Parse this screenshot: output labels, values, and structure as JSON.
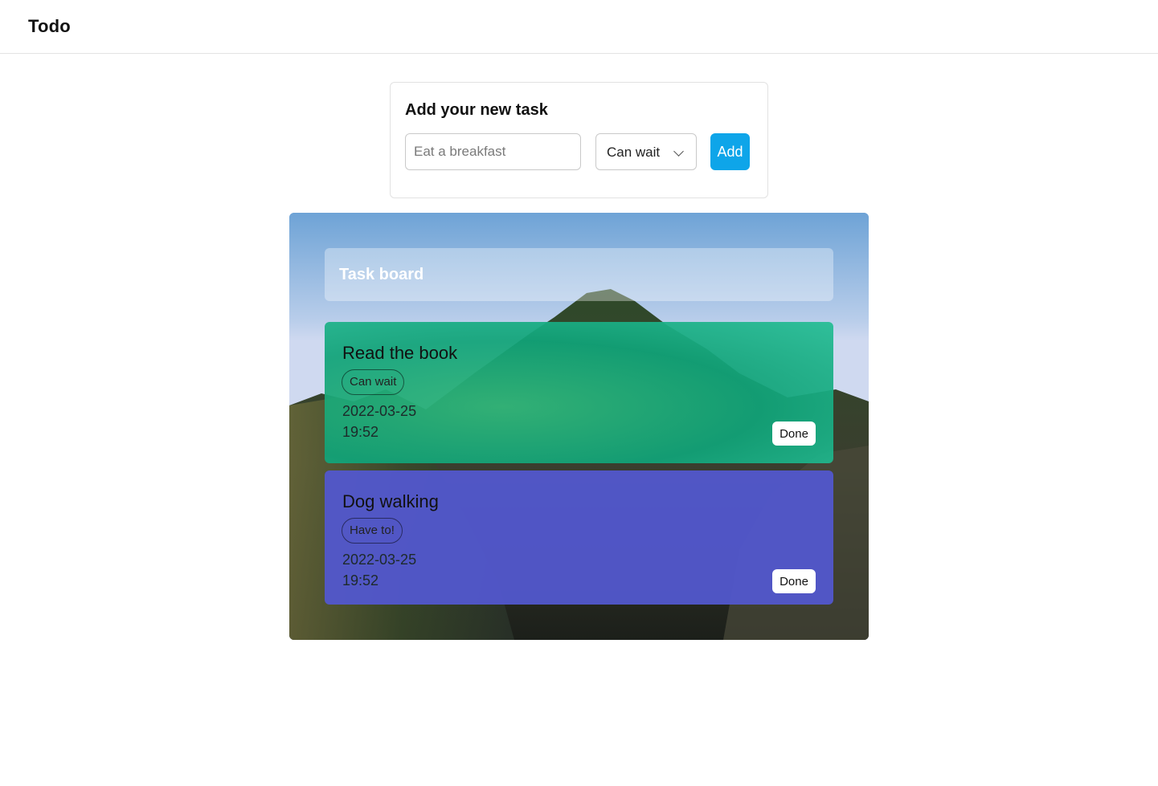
{
  "app": {
    "title": "Todo"
  },
  "form": {
    "title": "Add your new task",
    "input_placeholder": "Eat a breakfast",
    "priority_selected": "Can wait",
    "add_label": "Add"
  },
  "board": {
    "title": "Task board",
    "tasks": [
      {
        "title": "Read the book",
        "tag": "Can wait",
        "date": "2022-03-25",
        "time": "19:52",
        "done_label": "Done",
        "color": "#10a37a"
      },
      {
        "title": "Dog walking",
        "tag": "Have to!",
        "date": "2022-03-25",
        "time": "19:52",
        "done_label": "Done",
        "color": "#5257cd"
      }
    ]
  },
  "colors": {
    "accent": "#0ea5e9",
    "border": "#e2e2e2"
  }
}
